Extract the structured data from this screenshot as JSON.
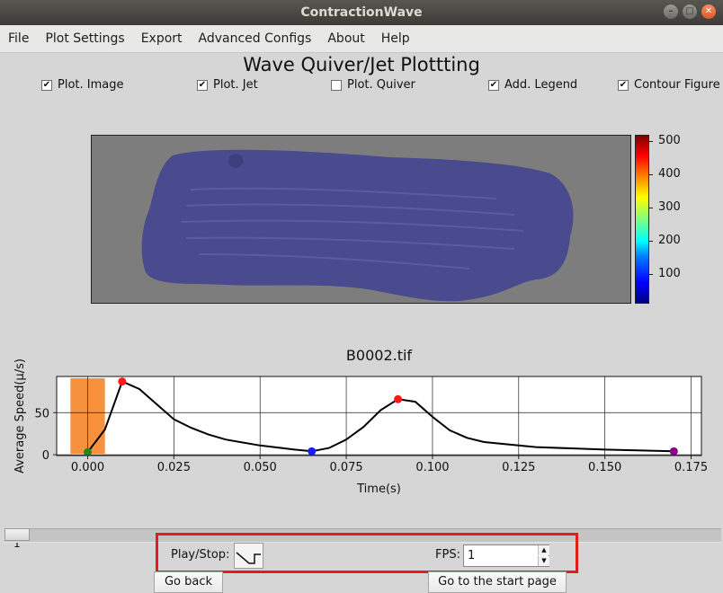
{
  "window": {
    "title": "ContractionWave"
  },
  "menu": [
    "File",
    "Plot Settings",
    "Export",
    "Advanced Configs",
    "About",
    "Help"
  ],
  "page": {
    "title": "Wave Quiver/Jet Plottting"
  },
  "checkboxes": [
    {
      "label": "Plot. Image",
      "checked": true
    },
    {
      "label": "Plot. Jet",
      "checked": true
    },
    {
      "label": "Plot. Quiver",
      "checked": false
    },
    {
      "label": "Add. Legend",
      "checked": true
    },
    {
      "label": "Contour Figure",
      "checked": true
    }
  ],
  "heatmap": {
    "colorbar_ticks": [
      "500",
      "400",
      "300",
      "200",
      "100"
    ],
    "colormap": "jet",
    "overlay_color": "#4a4a8e"
  },
  "chart_data": {
    "type": "line",
    "title": "B0002.tif",
    "xlabel": "Time(s)",
    "ylabel": "Average Speed(μ/s)",
    "xlim": [
      -0.009,
      0.178
    ],
    "ylim": [
      -1,
      93
    ],
    "xticks": [
      "0.000",
      "0.025",
      "0.050",
      "0.075",
      "0.100",
      "0.125",
      "0.150",
      "0.175"
    ],
    "yticks": [
      "0",
      "50"
    ],
    "grid": true,
    "series": [
      {
        "color": "#000000",
        "x": [
          0.0,
          0.005,
          0.01,
          0.015,
          0.02,
          0.025,
          0.03,
          0.035,
          0.04,
          0.05,
          0.06,
          0.065,
          0.07,
          0.075,
          0.08,
          0.085,
          0.09,
          0.095,
          0.1,
          0.105,
          0.11,
          0.115,
          0.13,
          0.15,
          0.17
        ],
        "y": [
          3,
          30,
          87,
          78,
          60,
          42,
          32,
          24,
          18,
          11,
          6,
          4,
          8,
          18,
          33,
          53,
          66,
          63,
          45,
          29,
          20,
          15,
          9,
          6,
          4
        ]
      }
    ],
    "highlight_span": {
      "x": [
        -0.005,
        0.005
      ],
      "color": "#f6913d"
    },
    "markers": [
      {
        "x": 0.0,
        "y": 3,
        "color": "#1e8a1e"
      },
      {
        "x": 0.01,
        "y": 87,
        "color": "#ff1a1a"
      },
      {
        "x": 0.065,
        "y": 4,
        "color": "#1a1aff"
      },
      {
        "x": 0.09,
        "y": 66,
        "color": "#ff1a1a"
      },
      {
        "x": 0.17,
        "y": 4,
        "color": "#8b008b"
      }
    ]
  },
  "frame_slider": {
    "value": "1"
  },
  "controls": {
    "play_label": "Play/Stop:",
    "fps_label": "FPS:",
    "fps_value": "1",
    "highlight_color": "#e21b1b"
  },
  "buttons": {
    "back": "Go back",
    "start": "Go to the start page"
  }
}
